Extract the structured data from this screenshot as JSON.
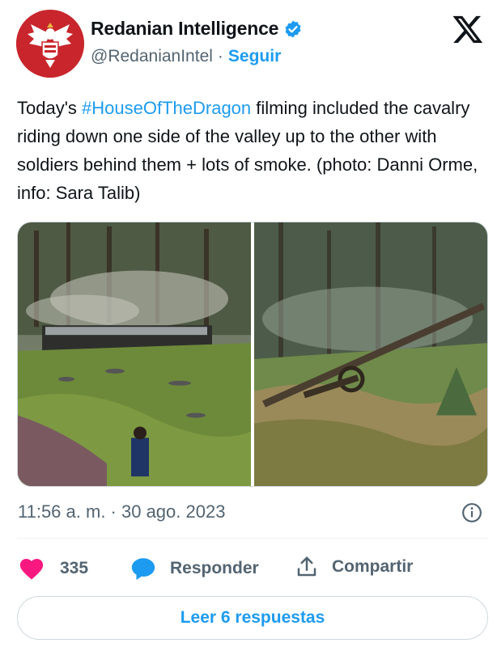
{
  "header": {
    "display_name": "Redanian Intelligence",
    "handle": "@RedanianIntel",
    "separator": "·",
    "follow_label": "Seguir",
    "verified_icon": "verified-badge-icon",
    "platform_icon": "x-logo-icon"
  },
  "tweet": {
    "text_before": "Today's ",
    "hashtag": "#HouseOfTheDragon",
    "text_after": " filming included the cavalry riding down one side of the valley up to the other with soldiers behind them + lots of smoke. (photo: Danni Orme, info: Sara Talib)"
  },
  "media": {
    "count": 2
  },
  "meta": {
    "timestamp": "11:56 a. m. · 30 ago. 2023"
  },
  "actions": {
    "likes_count": "335",
    "reply_label": "Responder",
    "share_label": "Compartir"
  },
  "footer": {
    "read_replies_label": "Leer 6 respuestas"
  },
  "colors": {
    "accent": "#1d9bf0",
    "like": "#f91880",
    "text": "#0f1419",
    "muted": "#536471"
  }
}
